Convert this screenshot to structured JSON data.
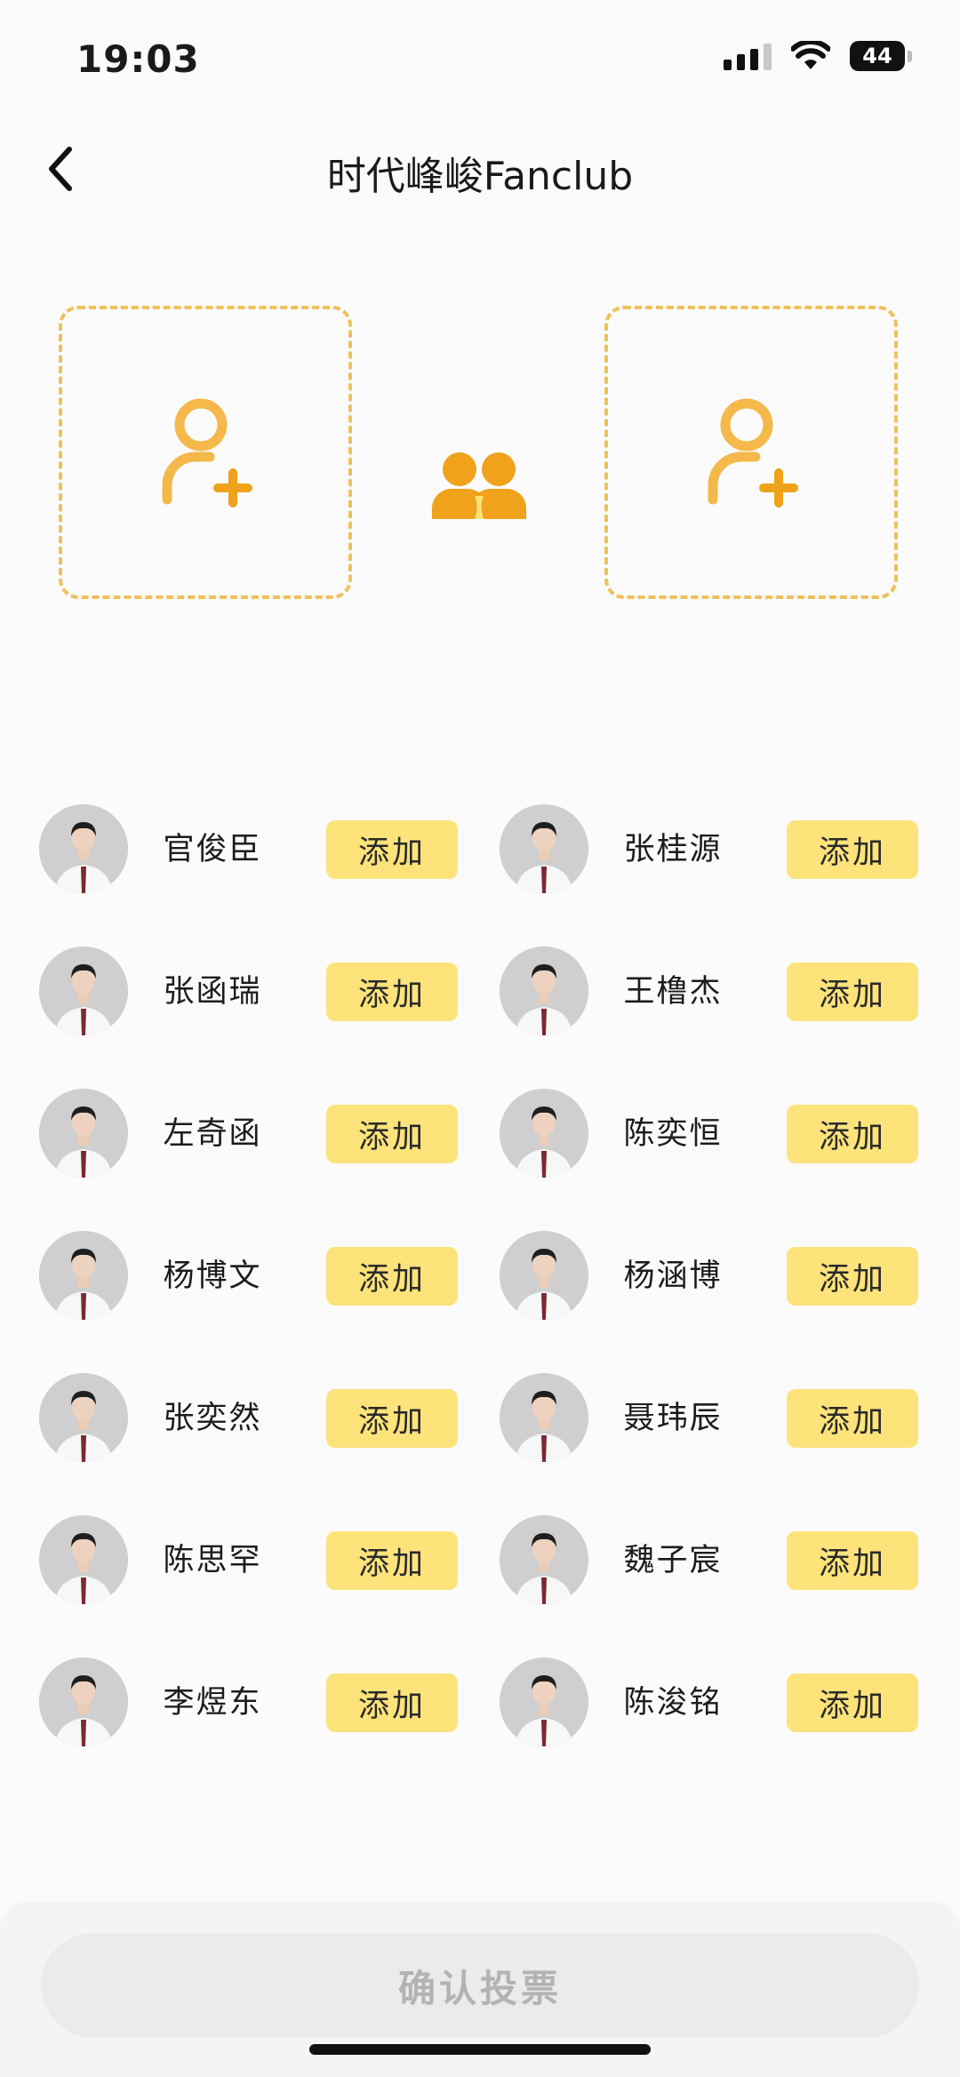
{
  "status_bar": {
    "time": "19:03",
    "battery": "44",
    "signal_icon": "cellular-signal-icon",
    "wifi_icon": "wifi-icon"
  },
  "nav": {
    "title": "时代峰峻Fanclub",
    "back_icon": "chevron-left-icon"
  },
  "vote_slots": [
    {
      "icon": "add-user-icon"
    },
    {
      "icon": "add-user-icon"
    }
  ],
  "pair_icon": "two-users-icon",
  "members": [
    {
      "name": "官俊臣",
      "action": "添加"
    },
    {
      "name": "张桂源",
      "action": "添加"
    },
    {
      "name": "张函瑞",
      "action": "添加"
    },
    {
      "name": "王橹杰",
      "action": "添加"
    },
    {
      "name": "左奇函",
      "action": "添加"
    },
    {
      "name": "陈奕恒",
      "action": "添加"
    },
    {
      "name": "杨博文",
      "action": "添加"
    },
    {
      "name": "杨涵博",
      "action": "添加"
    },
    {
      "name": "张奕然",
      "action": "添加"
    },
    {
      "name": "聂玮辰",
      "action": "添加"
    },
    {
      "name": "陈思罕",
      "action": "添加"
    },
    {
      "name": "魏子宸",
      "action": "添加"
    },
    {
      "name": "李煜东",
      "action": "添加"
    },
    {
      "name": "陈浚铭",
      "action": "添加"
    }
  ],
  "confirm_button": "确认投票",
  "colors": {
    "accent_orange": "#f0a21a",
    "slot_border": "#f0c05a",
    "add_button_bg": "#fde37a",
    "confirm_disabled_bg": "#ebebeb"
  }
}
